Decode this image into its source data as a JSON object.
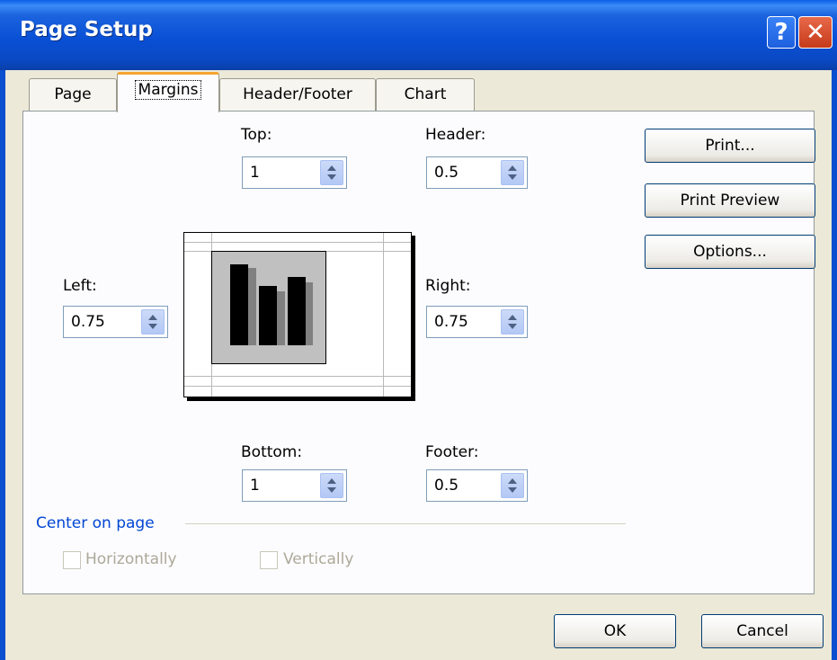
{
  "window": {
    "title": "Page Setup",
    "help_symbol": "?",
    "close_symbol": "✕"
  },
  "tabs": [
    {
      "label": "Page",
      "active": false
    },
    {
      "label": "Margins",
      "active": true
    },
    {
      "label": "Header/Footer",
      "active": false
    },
    {
      "label": "Chart",
      "active": false
    }
  ],
  "margins": {
    "top": {
      "label": "Top:",
      "value": "1"
    },
    "header": {
      "label": "Header:",
      "value": "0.5"
    },
    "left": {
      "label": "Left:",
      "value": "0.75"
    },
    "right": {
      "label": "Right:",
      "value": "0.75"
    },
    "bottom": {
      "label": "Bottom:",
      "value": "1"
    },
    "footer": {
      "label": "Footer:",
      "value": "0.5"
    }
  },
  "buttons": {
    "print": "Print...",
    "print_preview": "Print Preview",
    "options": "Options...",
    "ok": "OK",
    "cancel": "Cancel"
  },
  "center_on_page": {
    "label": "Center on page",
    "horizontally": "Horizontally",
    "vertically": "Vertically",
    "horizontally_checked": false,
    "vertically_checked": false,
    "enabled": false
  }
}
